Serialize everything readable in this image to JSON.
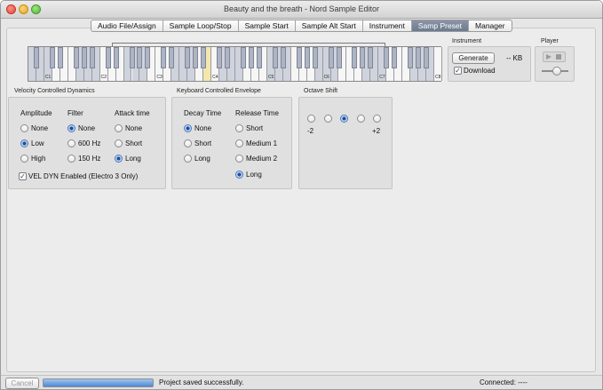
{
  "window": {
    "title": "Beauty and the breath - Nord Sample Editor"
  },
  "tabs": [
    "Audio File/Assign",
    "Sample Loop/Stop",
    "Sample Start",
    "Sample Alt Start",
    "Instrument",
    "Samp Preset",
    "Manager"
  ],
  "active_tab": "Samp Preset",
  "keyboard": {
    "octave_labels": [
      "C1",
      "C2",
      "C3",
      "C4",
      "C5",
      "C6",
      "C7",
      "C8"
    ]
  },
  "instrument": {
    "title": "Instrument",
    "generate_label": "Generate",
    "size_text": "-- KB",
    "download_label": "Download",
    "download_checked": true
  },
  "player": {
    "title": "Player"
  },
  "velocity": {
    "title": "Velocity Controlled Dynamics",
    "amplitude": {
      "label": "Amplitude",
      "options": [
        "None",
        "Low",
        "High"
      ],
      "selected": "Low"
    },
    "filter": {
      "label": "Filter",
      "options": [
        "None",
        "600 Hz",
        "150 Hz"
      ],
      "selected": "None"
    },
    "attack": {
      "label": "Attack time",
      "options": [
        "None",
        "Short",
        "Long"
      ],
      "selected": "Long"
    },
    "vel_dyn_label": "VEL DYN Enabled (Electro 3 Only)",
    "vel_dyn_checked": true
  },
  "envelope": {
    "title": "Keyboard Controlled Envelope",
    "decay": {
      "label": "Decay Time",
      "options": [
        "None",
        "Short",
        "Long"
      ],
      "selected": "None"
    },
    "release": {
      "label": "Release Time",
      "options": [
        "Short",
        "Medium 1",
        "Medium 2",
        "Long"
      ],
      "selected": "Long"
    }
  },
  "octave": {
    "title": "Octave Shift",
    "min_label": "-2",
    "max_label": "+2",
    "selected_index": 2,
    "count": 5
  },
  "status": {
    "cancel_label": "Cancel",
    "message": "Project saved successfully.",
    "connected": "Connected: ----",
    "progress": 1.0
  }
}
